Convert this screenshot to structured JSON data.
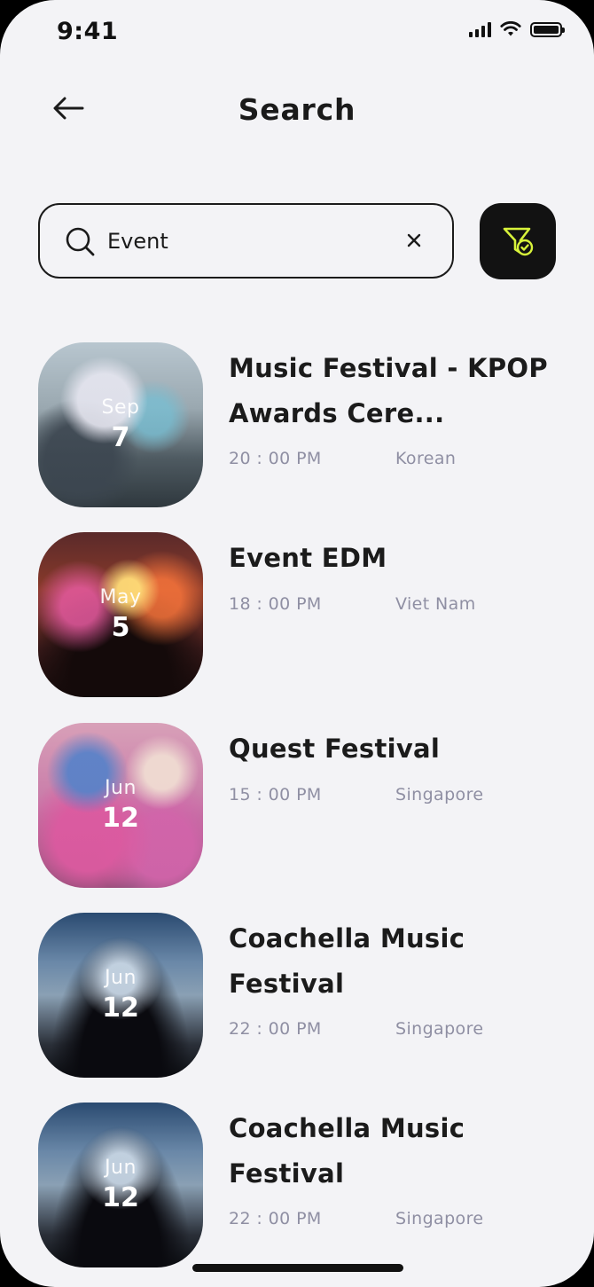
{
  "status_bar": {
    "time": "9:41"
  },
  "header": {
    "title": "Search"
  },
  "search": {
    "value": "Event",
    "placeholder": ""
  },
  "colors": {
    "filter_accent": "#d7f23a",
    "filter_bg": "#121212",
    "background": "#f3f3f6"
  },
  "events": [
    {
      "month": "Sep",
      "day": "7",
      "title": "Music Festival - KPOP Awards Cere...",
      "time": "20 : 00 PM",
      "location": "Korean"
    },
    {
      "month": "May",
      "day": "5",
      "title": "Event EDM",
      "time": "18 : 00 PM",
      "location": "Viet Nam"
    },
    {
      "month": "Jun",
      "day": "12",
      "title": "Quest Festival",
      "time": "15 : 00 PM",
      "location": "Singapore"
    },
    {
      "month": "Jun",
      "day": "12",
      "title": "Coachella Music Festival",
      "time": "22 : 00 PM",
      "location": "Singapore"
    },
    {
      "month": "Jun",
      "day": "12",
      "title": "Coachella Music Festival",
      "time": "22 : 00 PM",
      "location": "Singapore"
    }
  ]
}
